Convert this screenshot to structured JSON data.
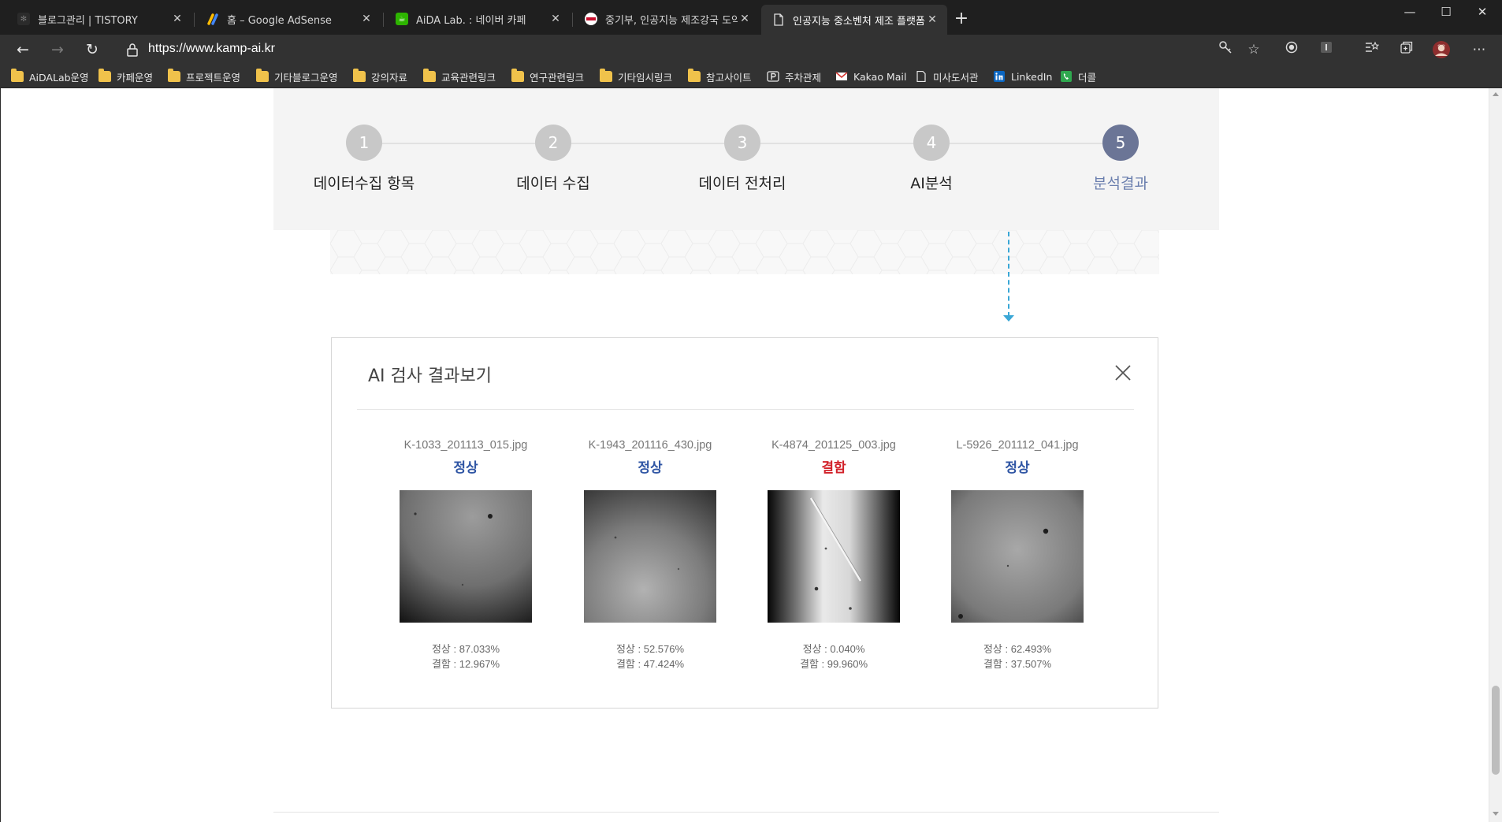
{
  "browser": {
    "tabs": [
      {
        "title": "블로그관리 | TISTORY",
        "icon": "tistory-icon"
      },
      {
        "title": "홈 – Google AdSense",
        "icon": "adsense-icon"
      },
      {
        "title": "AiDA Lab. : 네이버 카페",
        "icon": "naver-cafe-icon"
      },
      {
        "title": "중기부, 인공지능 제조강국 도약",
        "icon": "news-icon"
      },
      {
        "title": "인공지능 중소벤처 제조 플랫폼",
        "icon": "page-icon",
        "active": true
      }
    ],
    "url": "https://www.kamp-ai.kr",
    "bookmarks": [
      {
        "label": "AiDALab운영",
        "icon": "folder-icon"
      },
      {
        "label": "카페운영",
        "icon": "folder-icon"
      },
      {
        "label": "프로젝트운영",
        "icon": "folder-icon"
      },
      {
        "label": "기타블로그운영",
        "icon": "folder-icon"
      },
      {
        "label": "강의자료",
        "icon": "folder-icon"
      },
      {
        "label": "교육관련링크",
        "icon": "folder-icon"
      },
      {
        "label": "연구관련링크",
        "icon": "folder-icon"
      },
      {
        "label": "기타임시링크",
        "icon": "folder-icon"
      },
      {
        "label": "참고사이트",
        "icon": "folder-icon"
      },
      {
        "label": "주차관제",
        "icon": "parking-icon"
      },
      {
        "label": "Kakao Mail",
        "icon": "mail-icon"
      },
      {
        "label": "미사도서관",
        "icon": "page-icon"
      },
      {
        "label": "LinkedIn",
        "icon": "linkedin-icon"
      },
      {
        "label": "더콜",
        "icon": "phone-icon"
      }
    ]
  },
  "steps": [
    {
      "number": "1",
      "label": "데이터수집 항목"
    },
    {
      "number": "2",
      "label": "데이터 수집"
    },
    {
      "number": "3",
      "label": "데이터 전처리"
    },
    {
      "number": "4",
      "label": "AI분석"
    },
    {
      "number": "5",
      "label": "분석결과",
      "active": true
    }
  ],
  "result": {
    "title": "AI 검사 결과보기",
    "items": [
      {
        "filename": "K-1033_201113_015.jpg",
        "status": "정상",
        "status_color": "#2f55a4",
        "normal": "정상 : 87.033%",
        "defect": "결함 : 12.967%"
      },
      {
        "filename": "K-1943_201116_430.jpg",
        "status": "정상",
        "status_color": "#2f55a4",
        "normal": "정상 : 52.576%",
        "defect": "결함 : 47.424%"
      },
      {
        "filename": "K-4874_201125_003.jpg",
        "status": "결함",
        "status_color": "#d2222a",
        "normal": "정상 : 0.040%",
        "defect": "결함 : 99.960%"
      },
      {
        "filename": "L-5926_201112_041.jpg",
        "status": "정상",
        "status_color": "#2f55a4",
        "normal": "정상 : 62.493%",
        "defect": "결함 : 37.507%"
      }
    ]
  },
  "colors": {
    "accent_blue": "#3aa7d6",
    "active_step": "#6b7596",
    "normal_text": "#2f55a4",
    "defect_text": "#d2222a"
  }
}
